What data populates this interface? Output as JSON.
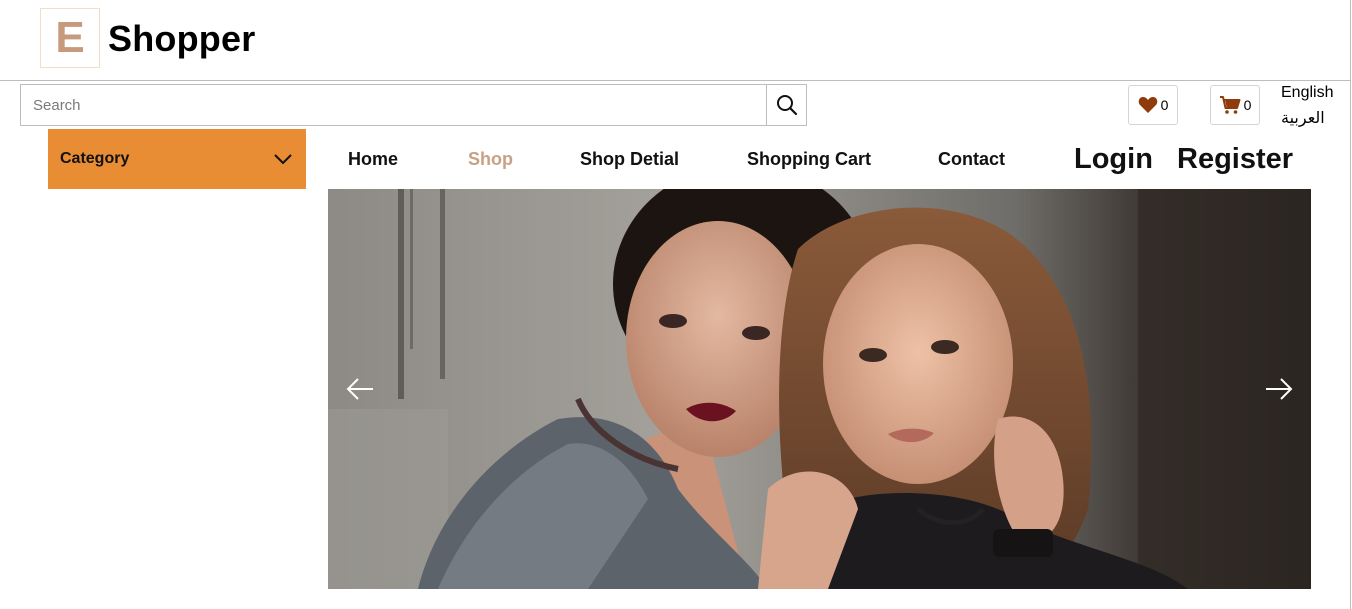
{
  "brand": {
    "logo_letter": "E",
    "name": "Shopper"
  },
  "search": {
    "placeholder": "Search"
  },
  "header": {
    "wishlist_count": "0",
    "cart_count": "0",
    "languages": [
      "English",
      "العربية"
    ]
  },
  "category": {
    "label": "Category"
  },
  "nav": {
    "items": [
      {
        "label": "Home"
      },
      {
        "label": "Shop"
      },
      {
        "label": "Shop Detial"
      },
      {
        "label": "Shopping Cart"
      },
      {
        "label": "Contact"
      }
    ],
    "login": "Login",
    "register": "Register"
  },
  "icons": {
    "search": "search-icon",
    "wishlist": "heart-icon",
    "cart": "cart-icon",
    "category_toggle": "chevron-down-icon",
    "prev": "arrow-left-icon",
    "next": "arrow-right-icon"
  },
  "colors": {
    "accent": "#e88d34",
    "active_nav": "#c8a184",
    "icon_brown": "#8f3c0c",
    "logo": "#c69a7a"
  }
}
